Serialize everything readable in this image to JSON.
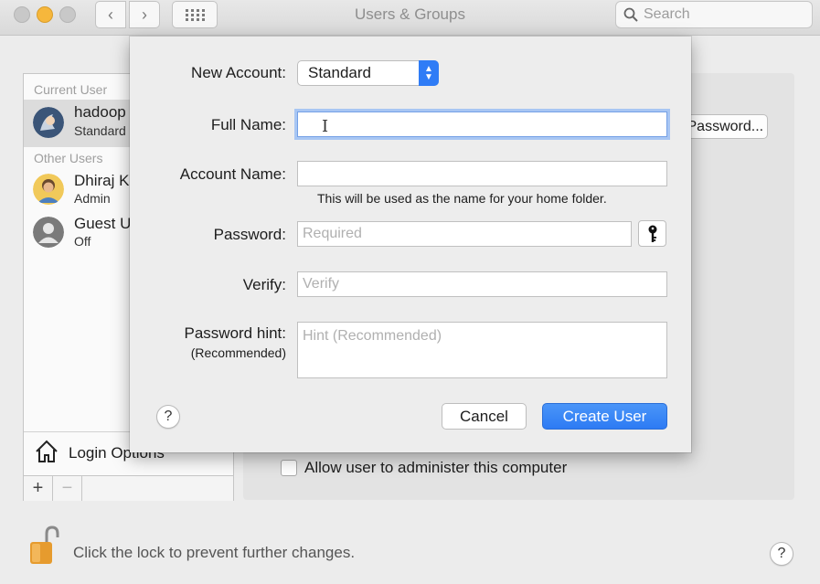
{
  "window": {
    "title": "Users & Groups",
    "search_placeholder": "Search"
  },
  "sidebar": {
    "current_user_label": "Current User",
    "current_user": {
      "name": "hadoop",
      "role": "Standard"
    },
    "other_users_label": "Other Users",
    "other_users": [
      {
        "name": "Dhiraj K",
        "role": "Admin"
      },
      {
        "name": "Guest U",
        "role": "Off"
      }
    ],
    "login_options_label": "Login Options",
    "add_symbol": "+",
    "remove_symbol": "−"
  },
  "detail": {
    "change_password_label": "Change Password...",
    "allow_admin_label": "Allow user to administer this computer"
  },
  "footer": {
    "lock_text": "Click the lock to prevent further changes."
  },
  "sheet": {
    "new_account_label": "New Account:",
    "new_account_value": "Standard",
    "full_name_label": "Full Name:",
    "full_name_value": "",
    "account_name_label": "Account Name:",
    "account_name_value": "",
    "home_folder_note": "This will be used as the name for your home folder.",
    "password_label": "Password:",
    "password_placeholder": "Required",
    "verify_label": "Verify:",
    "verify_placeholder": "Verify",
    "hint_label": "Password hint:",
    "hint_sublabel": "(Recommended)",
    "hint_placeholder": "Hint (Recommended)",
    "cancel_label": "Cancel",
    "create_label": "Create User",
    "help_symbol": "?"
  },
  "colors": {
    "accent": "#2d7bf4",
    "focus_ring": "#a8c6f3",
    "lock": "#e69b2e"
  }
}
